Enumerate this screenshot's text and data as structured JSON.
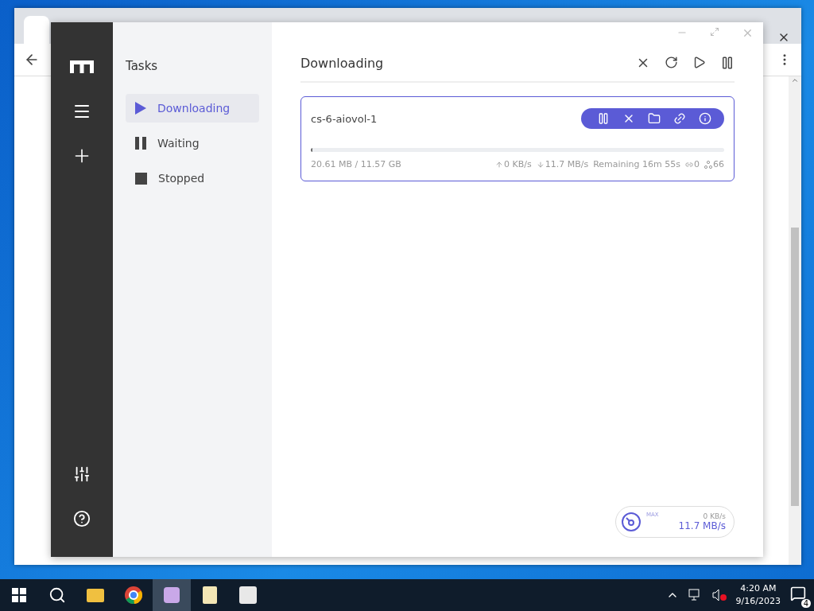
{
  "sidebar": {
    "title": "Tasks",
    "items": [
      {
        "label": "Downloading",
        "kind": "play",
        "selected": true
      },
      {
        "label": "Waiting",
        "kind": "pause",
        "selected": false
      },
      {
        "label": "Stopped",
        "kind": "stop",
        "selected": false
      }
    ]
  },
  "list": {
    "title": "Downloading"
  },
  "tasks": [
    {
      "name": "cs-6-aiovol-1",
      "level": 0.003,
      "size": "20.61 MB / 11.57 GB",
      "upload": "0 KB/s",
      "download": "11.7 MB/s",
      "remaining": "Remaining 16m 55s",
      "seeders": "0",
      "peers": "66",
      "selected": true
    }
  ],
  "speedometer": {
    "label": "MAX",
    "upload": "0 KB/s",
    "download": "11.7 MB/s"
  },
  "taskbar": {
    "time": "4:20 AM",
    "date": "9/16/2023",
    "notifications": "4"
  }
}
